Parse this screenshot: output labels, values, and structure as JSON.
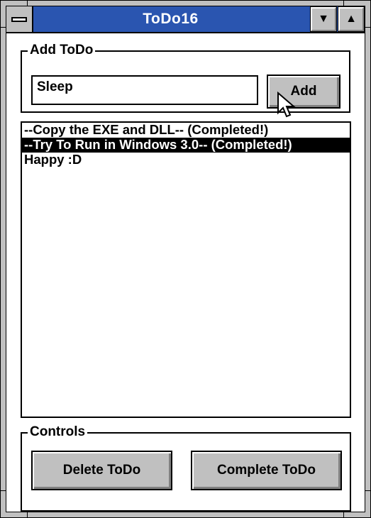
{
  "window": {
    "title": "ToDo16"
  },
  "titlebar": {
    "system_menu_icon": "system-menu-icon",
    "minimize_glyph": "▼",
    "maximize_glyph": "▲"
  },
  "add_group": {
    "label": "Add ToDo",
    "input_value": "Sleep",
    "add_button_label": "Add"
  },
  "todo_list": {
    "items": [
      {
        "text": "--Copy the EXE and DLL-- (Completed!)",
        "selected": false
      },
      {
        "text": "--Try To Run in Windows 3.0-- (Completed!)",
        "selected": true
      },
      {
        "text": "Happy :D",
        "selected": false
      }
    ]
  },
  "controls_group": {
    "label": "Controls",
    "delete_button_label": "Delete ToDo",
    "complete_button_label": "Complete ToDo"
  },
  "colors": {
    "titlebar": "#2a55b0",
    "button_face": "#c0c0c0",
    "selection": "#000000"
  }
}
